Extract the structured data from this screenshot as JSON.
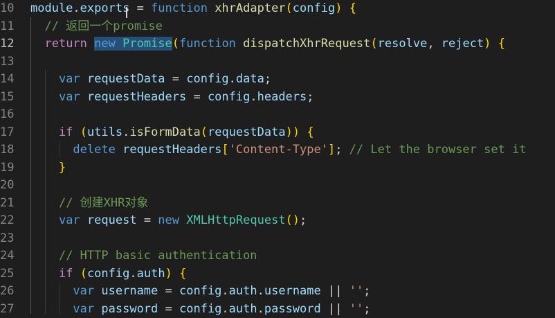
{
  "editor": {
    "lines": [
      {
        "num": "10",
        "tokens": [
          [
            "var",
            "module"
          ],
          [
            "pun",
            "."
          ],
          [
            "var",
            "exports"
          ],
          [
            "pun",
            " = "
          ],
          [
            "kw",
            "function"
          ],
          [
            "pun",
            " "
          ],
          [
            "fn",
            "xhrAdapter"
          ],
          [
            "brk",
            "("
          ],
          [
            "var",
            "config"
          ],
          [
            "brk",
            ")"
          ],
          [
            "pun",
            " "
          ],
          [
            "brk",
            "{"
          ]
        ]
      },
      {
        "num": "11",
        "tokens": [
          [
            "pun",
            "  "
          ],
          [
            "cmt",
            "// 返回一个promise"
          ]
        ]
      },
      {
        "num": "12",
        "active": true,
        "tokens": [
          [
            "pun",
            "  "
          ],
          [
            "ctl",
            "return"
          ],
          [
            "pun",
            " "
          ],
          [
            "kw sel",
            "new"
          ],
          [
            "pun sel",
            " "
          ],
          [
            "typ sel",
            "Promise"
          ],
          [
            "brk",
            "("
          ],
          [
            "kw",
            "function"
          ],
          [
            "pun",
            " "
          ],
          [
            "fn",
            "dispatchXhrRequest"
          ],
          [
            "brk",
            "("
          ],
          [
            "var",
            "resolve"
          ],
          [
            "pun",
            ", "
          ],
          [
            "var",
            "reject"
          ],
          [
            "brk",
            ")"
          ],
          [
            "pun",
            " "
          ],
          [
            "brk",
            "{"
          ]
        ]
      },
      {
        "num": "13",
        "tokens": []
      },
      {
        "num": "14",
        "tokens": [
          [
            "pun",
            "    "
          ],
          [
            "kw",
            "var"
          ],
          [
            "pun",
            " "
          ],
          [
            "var",
            "requestData"
          ],
          [
            "pun",
            " = "
          ],
          [
            "var",
            "config"
          ],
          [
            "pun",
            "."
          ],
          [
            "var",
            "data"
          ],
          [
            "pun",
            ";"
          ]
        ]
      },
      {
        "num": "15",
        "tokens": [
          [
            "pun",
            "    "
          ],
          [
            "kw",
            "var"
          ],
          [
            "pun",
            " "
          ],
          [
            "var",
            "requestHeaders"
          ],
          [
            "pun",
            " = "
          ],
          [
            "var",
            "config"
          ],
          [
            "pun",
            "."
          ],
          [
            "var",
            "headers"
          ],
          [
            "pun",
            ";"
          ]
        ]
      },
      {
        "num": "16",
        "tokens": []
      },
      {
        "num": "17",
        "tokens": [
          [
            "pun",
            "    "
          ],
          [
            "ctl",
            "if"
          ],
          [
            "pun",
            " "
          ],
          [
            "brk",
            "("
          ],
          [
            "var",
            "utils"
          ],
          [
            "pun",
            "."
          ],
          [
            "fn",
            "isFormData"
          ],
          [
            "brk",
            "("
          ],
          [
            "var",
            "requestData"
          ],
          [
            "brk",
            "))"
          ],
          [
            "pun",
            " "
          ],
          [
            "brk",
            "{"
          ]
        ]
      },
      {
        "num": "18",
        "tokens": [
          [
            "pun",
            "      "
          ],
          [
            "kw",
            "delete"
          ],
          [
            "pun",
            " "
          ],
          [
            "var",
            "requestHeaders"
          ],
          [
            "brk",
            "["
          ],
          [
            "str",
            "'Content-Type'"
          ],
          [
            "brk",
            "]"
          ],
          [
            "pun",
            "; "
          ],
          [
            "cmt",
            "// Let the browser set it"
          ]
        ]
      },
      {
        "num": "19",
        "tokens": [
          [
            "pun",
            "    "
          ],
          [
            "brk",
            "}"
          ]
        ]
      },
      {
        "num": "20",
        "tokens": []
      },
      {
        "num": "21",
        "tokens": [
          [
            "pun",
            "    "
          ],
          [
            "cmt",
            "// 创建XHR对象"
          ]
        ]
      },
      {
        "num": "22",
        "tokens": [
          [
            "pun",
            "    "
          ],
          [
            "kw",
            "var"
          ],
          [
            "pun",
            " "
          ],
          [
            "var",
            "request"
          ],
          [
            "pun",
            " = "
          ],
          [
            "kw",
            "new"
          ],
          [
            "pun",
            " "
          ],
          [
            "typ",
            "XMLHttpRequest"
          ],
          [
            "brk",
            "()"
          ],
          [
            "pun",
            ";"
          ]
        ]
      },
      {
        "num": "23",
        "tokens": []
      },
      {
        "num": "24",
        "tokens": [
          [
            "pun",
            "    "
          ],
          [
            "cmt",
            "// HTTP basic authentication"
          ]
        ]
      },
      {
        "num": "25",
        "tokens": [
          [
            "pun",
            "    "
          ],
          [
            "ctl",
            "if"
          ],
          [
            "pun",
            " "
          ],
          [
            "brk",
            "("
          ],
          [
            "var",
            "config"
          ],
          [
            "pun",
            "."
          ],
          [
            "var",
            "auth"
          ],
          [
            "brk",
            ")"
          ],
          [
            "pun",
            " "
          ],
          [
            "brk",
            "{"
          ]
        ]
      },
      {
        "num": "26",
        "tokens": [
          [
            "pun",
            "      "
          ],
          [
            "kw",
            "var"
          ],
          [
            "pun",
            " "
          ],
          [
            "var",
            "username"
          ],
          [
            "pun",
            " = "
          ],
          [
            "var",
            "config"
          ],
          [
            "pun",
            "."
          ],
          [
            "var",
            "auth"
          ],
          [
            "pun",
            "."
          ],
          [
            "var",
            "username"
          ],
          [
            "pun",
            " || "
          ],
          [
            "str",
            "''"
          ],
          [
            "pun",
            ";"
          ]
        ]
      },
      {
        "num": "27",
        "tokens": [
          [
            "pun",
            "      "
          ],
          [
            "kw",
            "var"
          ],
          [
            "pun",
            " "
          ],
          [
            "var",
            "password"
          ],
          [
            "pun",
            " = "
          ],
          [
            "var",
            "config"
          ],
          [
            "pun",
            "."
          ],
          [
            "var",
            "auth"
          ],
          [
            "pun",
            "."
          ],
          [
            "var",
            "password"
          ],
          [
            "pun",
            " || "
          ],
          [
            "str",
            "''"
          ],
          [
            "pun",
            ";"
          ]
        ]
      }
    ]
  }
}
